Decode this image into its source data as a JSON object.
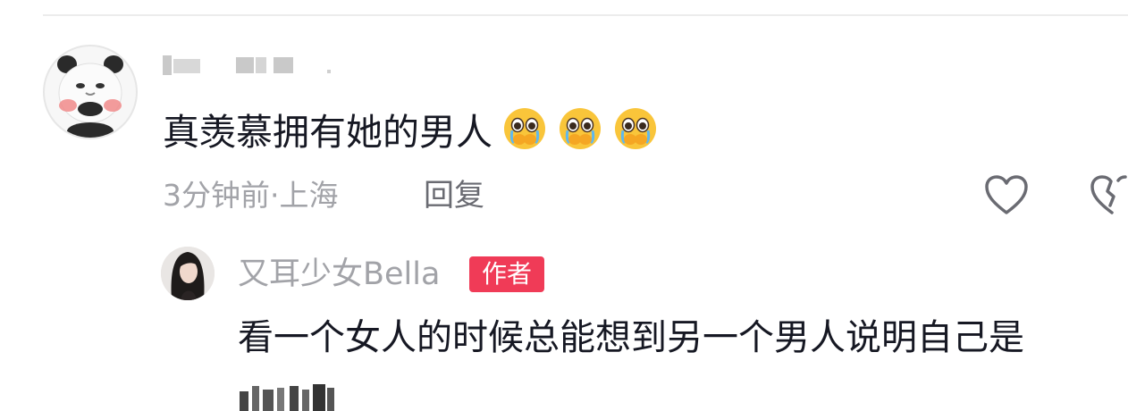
{
  "top_comment": {
    "text": "真羡慕拥有她的男人",
    "emojis": [
      "pleading-face-icon",
      "pleading-face-icon",
      "pleading-face-icon"
    ],
    "time": "3分钟前",
    "separator": "·",
    "location": "上海",
    "reply_label": "回复"
  },
  "reply": {
    "username": "又耳少女Bella",
    "badge": "作者",
    "text": "看一个女人的时候总能想到另一个男人说明自己是"
  },
  "colors": {
    "badge": "#f03b57",
    "muted_text": "#a2a3a8",
    "reply_button_text": "#6a6b72"
  }
}
